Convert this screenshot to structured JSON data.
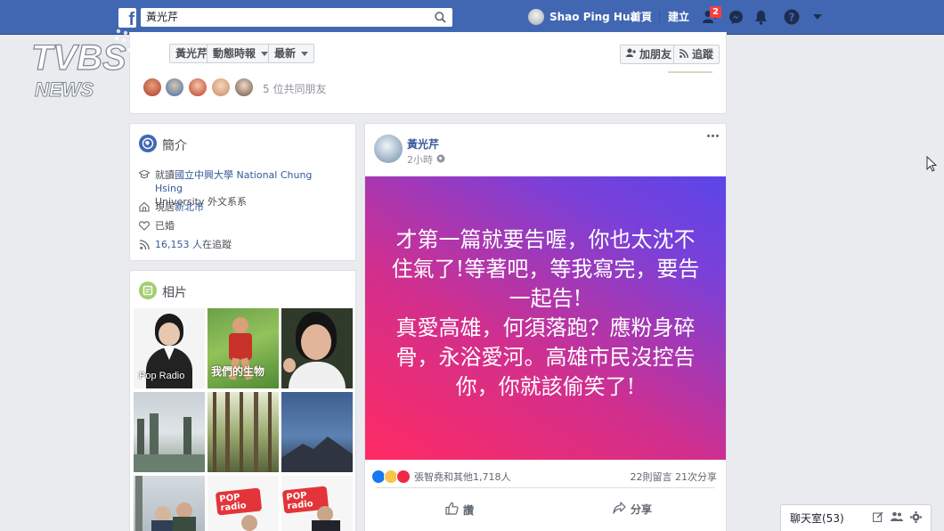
{
  "topbar": {
    "search_value": "黃光芹",
    "user_name": "Shao Ping Hua",
    "home_label": "首頁",
    "create_label": "建立",
    "friend_requests_count": "2"
  },
  "profile_header": {
    "name_tab": "黃光芹",
    "timeline_dropdown": "動態時報",
    "latest_dropdown": "最新",
    "add_friend_label": "加朋友",
    "follow_label": "追蹤",
    "mutual_friends": "5 位共同朋友"
  },
  "intro": {
    "title": "簡介",
    "education_prefix": "就讀",
    "education_link": "國立中興大學 National Chung Hsing",
    "education_suffix": "University 外文系系",
    "lives_prefix": "現居",
    "lives_link": "新北市",
    "relationship": "已婚",
    "followers_count": "16,153 人",
    "followers_suffix": "在追蹤"
  },
  "photos": {
    "title": "相片",
    "items": [
      {
        "caption": "Pop Radio"
      },
      {
        "caption": "我們的生物"
      },
      {
        "caption": ""
      },
      {
        "caption": ""
      },
      {
        "caption": ""
      },
      {
        "caption": ""
      },
      {
        "caption": ""
      },
      {
        "caption": "POP radio"
      },
      {
        "caption": "POP radio"
      }
    ]
  },
  "post": {
    "author": "黃光芹",
    "time": "2小時",
    "content_lines": [
      "才第一篇就要告喔，你也太沈不",
      "住氣了!等著吧，等我寫完，要告",
      "一起告!",
      "真愛高雄，何須落跑？應粉身碎",
      "骨，永浴愛河。高雄市民沒控告",
      "你，你就該偷笑了!"
    ],
    "reactions_text": "張智堯和其他1,718人",
    "comments_shares": "22則留言  21次分享",
    "like_label": "讚",
    "share_label": "分享"
  },
  "chat": {
    "label": "聊天室(53)"
  },
  "watermark": {
    "brand": "TVBS",
    "sub": "NEWS"
  },
  "colors": {
    "fb_blue": "#4267b2",
    "link_blue": "#365899",
    "gradient_pink": "#ff2a62",
    "gradient_purple": "#5b45e8"
  }
}
